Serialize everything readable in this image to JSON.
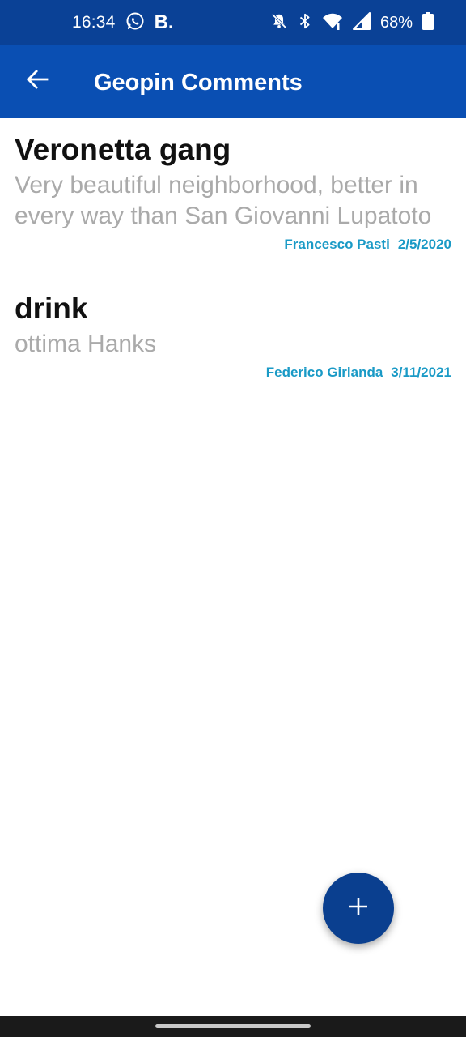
{
  "status_bar": {
    "time": "16:34",
    "booking_icon_text": "B.",
    "battery_percent": "68%",
    "icons": [
      "whatsapp-icon",
      "booking-icon",
      "bell-off-icon",
      "bluetooth-icon",
      "wifi-icon",
      "signal-icon",
      "battery-icon"
    ]
  },
  "app_bar": {
    "title": "Geopin Comments",
    "back_icon": "arrow-back-icon"
  },
  "comments": [
    {
      "title": "Veronetta gang",
      "body": "Very beautiful neighborhood, better in every way than San Giovanni Lupatoto",
      "author": "Francesco Pasti",
      "date": "2/5/2020"
    },
    {
      "title": "drink",
      "body": "ottima Hanks",
      "author": "Federico Girlanda",
      "date": "3/11/2021"
    }
  ],
  "fab": {
    "icon": "plus-icon"
  },
  "colors": {
    "status_bar": "#0a4196",
    "app_bar": "#0a4fb3",
    "fab": "#0a3f8f",
    "meta_text": "#1a9ac6",
    "body_text": "#aaaaaa"
  }
}
